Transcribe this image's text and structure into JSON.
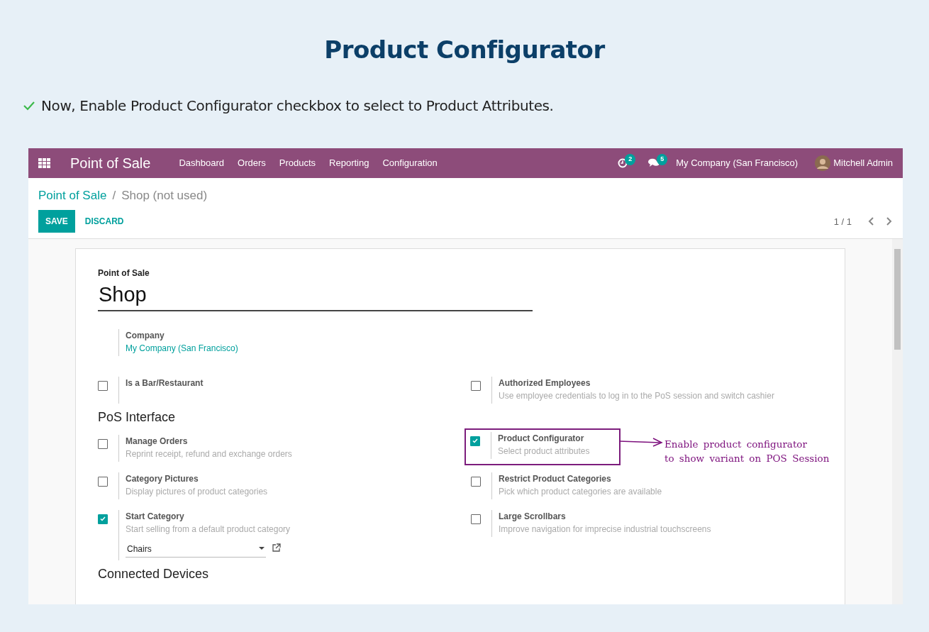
{
  "slide": {
    "title": "Product Configurator",
    "instruction": "Now, Enable  Product Configurator checkbox to select to Product Attributes."
  },
  "navbar": {
    "app_name": "Point of Sale",
    "menu": [
      "Dashboard",
      "Orders",
      "Products",
      "Reporting",
      "Configuration"
    ],
    "activity_count": "2",
    "message_count": "5",
    "company": "My Company (San Francisco)",
    "user": "Mitchell Admin"
  },
  "breadcrumb": [
    {
      "label": "Point of Sale",
      "kind": "link"
    },
    {
      "label": "/",
      "kind": "separator"
    },
    {
      "label": "Shop (not used)",
      "kind": "current"
    }
  ],
  "buttons": {
    "save": "SAVE",
    "discard": "DISCARD"
  },
  "pager": "1 / 1",
  "form": {
    "label": "Point of Sale",
    "name": "Shop",
    "company_label": "Company",
    "company_value": "My Company (San Francisco)",
    "settings": [
      {
        "title": "Is a Bar/Restaurant",
        "checked": false
      },
      {
        "title": "Authorized Employees",
        "description": "Use employee credentials to log in to the PoS session and switch cashier",
        "checked": false
      }
    ],
    "sections": [
      {
        "heading": "PoS Interface",
        "settings": [
          {
            "title": "Manage Orders",
            "description": "Reprint receipt, refund and exchange orders",
            "checked": false
          },
          {
            "title": "Product Configurator",
            "description": "Select product attributes",
            "checked": true,
            "highlighted": true,
            "annotation": [
              "Enable product configurator",
              "to show variant on POS Session"
            ]
          },
          {
            "title": "Category Pictures",
            "description": "Display pictures of product categories",
            "checked": false
          },
          {
            "title": "Restrict Product Categories",
            "description": "Pick which product categories are available",
            "checked": false
          },
          {
            "title": "Start Category",
            "description": "Start selling from a default product category",
            "checked": true,
            "select": "Chairs"
          },
          {
            "title": "Large Scrollbars",
            "description": "Improve navigation for imprecise industrial touchscreens",
            "checked": false
          }
        ]
      },
      {
        "heading": "Connected Devices"
      }
    ]
  }
}
